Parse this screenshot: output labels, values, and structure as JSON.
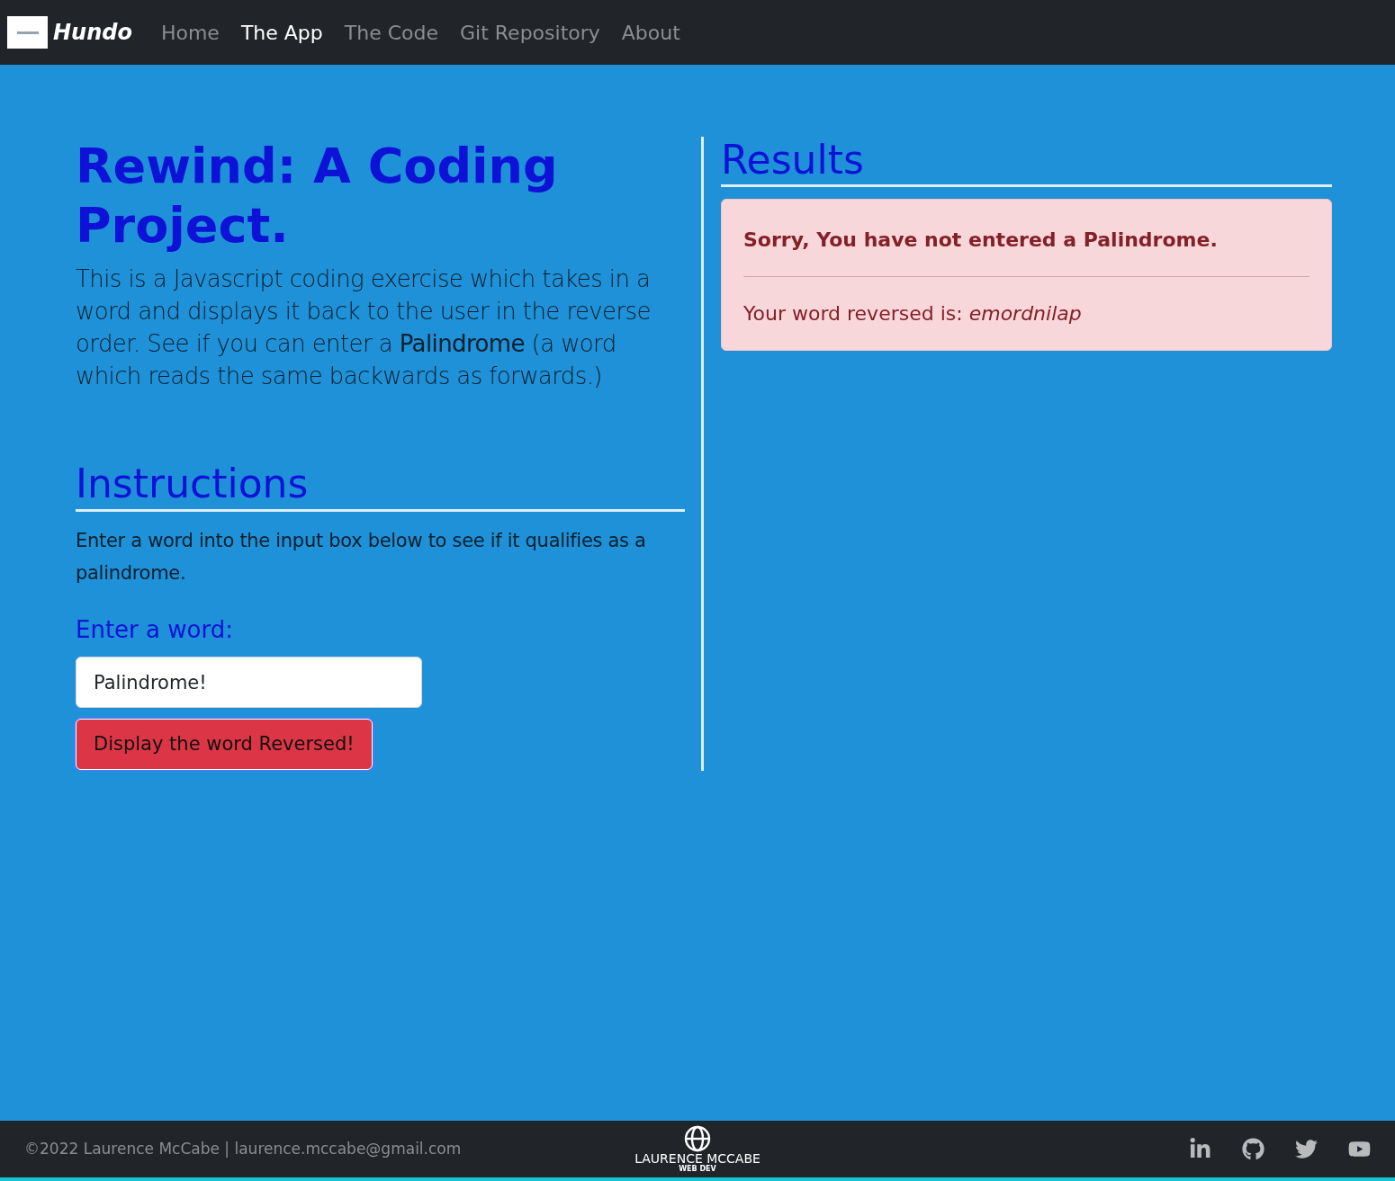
{
  "navbar": {
    "brand": "Hundo",
    "links": [
      {
        "label": "Home",
        "selected": false
      },
      {
        "label": "The App",
        "selected": true
      },
      {
        "label": "The Code",
        "selected": false
      },
      {
        "label": "Git Repository",
        "selected": false
      },
      {
        "label": "About",
        "selected": false
      }
    ]
  },
  "intro": {
    "title": "Rewind: A Coding Project.",
    "text": "This is a Javascript coding exercise which takes in a word and displays it back to the user in the reverse order. See if you can enter a **Palindrome** (a word which reads the same backwards as forwards.)"
  },
  "instructions": {
    "heading": "Instructions",
    "text": "Enter a word into the input box below to see if it qualifies as a palindrome.",
    "label": "Enter a word:",
    "input_value": "Palindrome!",
    "button": "Display the word Reversed!"
  },
  "results": {
    "heading": "Results",
    "alert_title": "Sorry, You have not entered a Palindrome.",
    "alert_text": "Your word reversed is: *emordnilap*"
  },
  "footer": {
    "copyright": "©2022 Laurence McCabe | laurence.mccabe@gmail.com",
    "logo_name": "LAURENCE MCCABE",
    "logo_sub": "WEB DEV"
  }
}
